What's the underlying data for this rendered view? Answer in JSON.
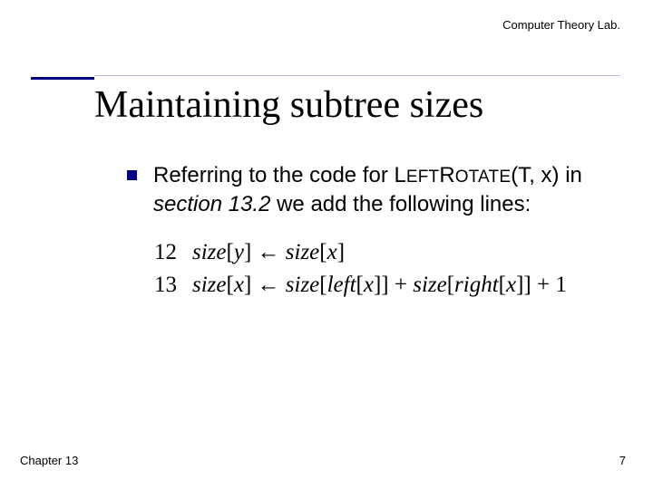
{
  "header": {
    "lab": "Computer Theory Lab."
  },
  "title": "Maintaining subtree sizes",
  "bullet": {
    "prefix": "Referring to the code for ",
    "func_cap1": "L",
    "func_low1": "eft",
    "func_cap2": "R",
    "func_low2": "otate",
    "args": "(T, x) in ",
    "section": "section 13.2 ",
    "suffix": "we add the following lines:"
  },
  "code": {
    "l1_num": "12",
    "l1_txt_a": "size",
    "l1_txt_b": "[",
    "l1_txt_c": "y",
    "l1_txt_d": "] ← ",
    "l1_txt_e": "size",
    "l1_txt_f": "[",
    "l1_txt_g": "x",
    "l1_txt_h": "]",
    "l2_num": "13",
    "l2_txt_a": "size",
    "l2_txt_b": "[",
    "l2_txt_c": "x",
    "l2_txt_d": "] ← ",
    "l2_txt_e": "size",
    "l2_txt_f": "[",
    "l2_txt_g": "left",
    "l2_txt_h": "[",
    "l2_txt_i": "x",
    "l2_txt_j": "]] + ",
    "l2_txt_k": "size",
    "l2_txt_l": "[",
    "l2_txt_m": "right",
    "l2_txt_n": "[",
    "l2_txt_o": "x",
    "l2_txt_p": "]] + 1"
  },
  "footer": {
    "chapter": "Chapter 13",
    "page": "7"
  }
}
